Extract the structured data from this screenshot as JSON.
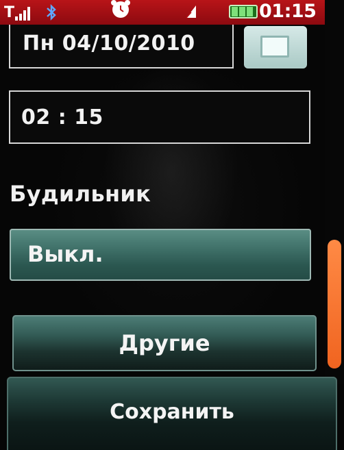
{
  "status_bar": {
    "signal_letter": "T",
    "clock": "01:15",
    "icons": [
      "signal-icon",
      "bluetooth-icon",
      "alarm-clock-icon",
      "message-icon",
      "battery-icon"
    ],
    "background_color": "#b81418"
  },
  "form": {
    "date_value": "Пн 04/10/2010",
    "time_value": "02 : 15",
    "alarm_label": "Будильник",
    "alarm_value": "Выкл."
  },
  "buttons": {
    "other_label": "Другие",
    "save_label": "Сохранить"
  },
  "colors": {
    "accent_teal": "#3e6f67",
    "scroll_thumb": "#f06420"
  }
}
